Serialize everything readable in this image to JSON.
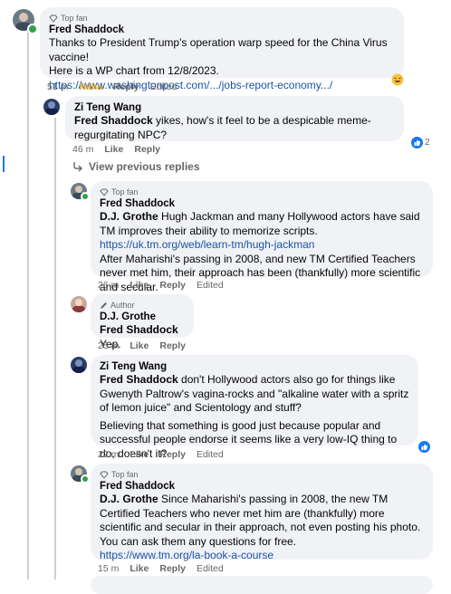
{
  "comments": [
    {
      "badge": "Top fan",
      "author": "Fred Shaddock",
      "lines": [
        "Thanks to President Trump's operation warp speed for the China Virus vaccine!",
        "Here is a WP chart from 12/8/2023."
      ],
      "link": "https://www.washingtonpost.com/.../jobs-report-economy.../",
      "time": "51 m",
      "reaction_label": "Haha",
      "reply": "Reply",
      "edited": "Edited"
    },
    {
      "author": "Zi Teng Wang",
      "mention": "Fred Shaddock",
      "text": " yikes, how's it feel to be a despicable meme-regurgitating NPC?",
      "time": "46 m",
      "like": "Like",
      "reply": "Reply",
      "reaction_count": "2"
    },
    {
      "view_previous": "View previous replies"
    },
    {
      "badge": "Top fan",
      "author": "Fred Shaddock",
      "mention": "D.J. Grothe",
      "text": " Hugh Jackman and many Hollywood actors have said TM improves their ability to memorize scripts.",
      "link": "https://uk.tm.org/web/learn-tm/hugh-jackman",
      "text2": "After Maharishi's passing in 2008, and new TM Certified Teachers never met him, their approach has been (thankfully) more scientific and secular.",
      "time": "26 m",
      "like": "Like",
      "reply": "Reply",
      "edited": "Edited"
    },
    {
      "badge": "Author",
      "author": "D.J. Grothe",
      "mention": "Fred Shaddock",
      "text": " Yep.",
      "time": "25 m",
      "like": "Like",
      "reply": "Reply"
    },
    {
      "author": "Zi Teng Wang",
      "mention": "Fred Shaddock",
      "text": " don't Hollywood actors also go for things like Gwenyth Paltrow's vagina-rocks and \"alkaline water with a spritz of lemon juice\" and Scientology and stuff?",
      "text2": "Believing that something is good just because popular and successful people endorse it seems like a very low-IQ thing to do, doesn't it?",
      "time": "22 m",
      "like": "Like",
      "reply": "Reply",
      "edited": "Edited"
    },
    {
      "badge": "Top fan",
      "author": "Fred Shaddock",
      "mention": "D.J. Grothe",
      "text": " Since Maharishi's passing in 2008, the new TM Certified Teachers who never met him are (thankfully) more scientific and secular in their approach, not even posting his photo. You can ask them any questions for free.",
      "link": "https://www.tm.org/la-book-a-course",
      "time": "15 m",
      "like": "Like",
      "reply": "Reply",
      "edited": "Edited"
    }
  ],
  "colors": {
    "link": "#1b53a5",
    "like_blue": "#1877f2",
    "bubble": "#f0f2f5",
    "online": "#31a24c"
  },
  "icons": {
    "top_fan": "diamond-badge-icon",
    "author": "pen-icon",
    "like_reaction": "thumbs-up-icon",
    "haha_reaction": "laughing-emoji-icon",
    "reply_arrow": "reply-arrow-icon"
  }
}
